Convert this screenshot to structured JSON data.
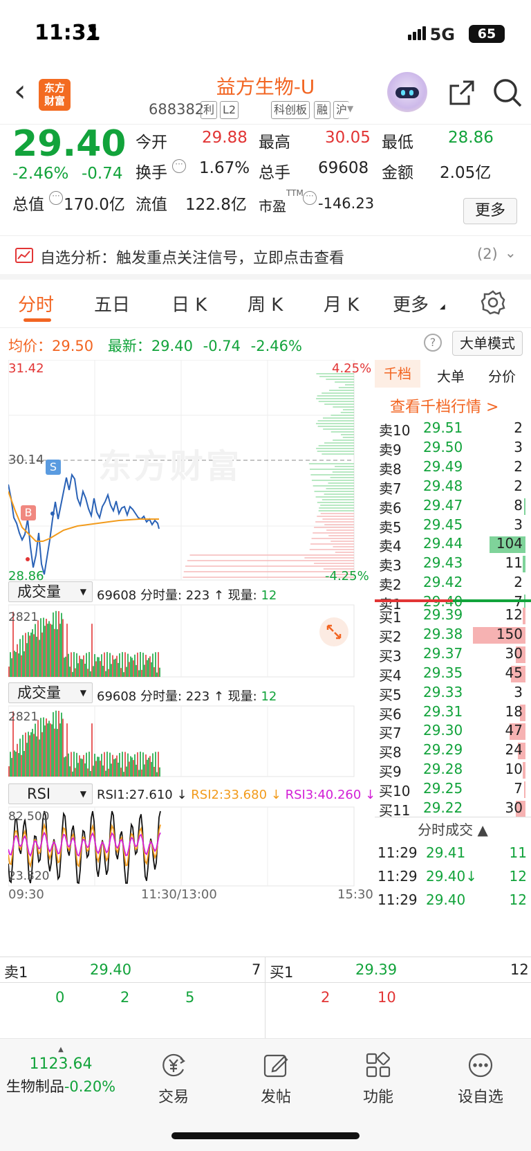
{
  "status_bar": {
    "time": "11:31",
    "network": "5G",
    "battery": "65"
  },
  "header": {
    "logo_line1": "东方",
    "logo_line2": "财富",
    "stock_name": "益方生物-U",
    "stock_code": "688382",
    "tags": [
      "利",
      "L2",
      "科创板",
      "融",
      "沪"
    ]
  },
  "quote": {
    "price": "29.40",
    "change_pct": "-2.46%",
    "change": "-0.74",
    "open_label": "今开",
    "open": "29.88",
    "high_label": "最高",
    "high": "30.05",
    "low_label": "最低",
    "low": "28.86",
    "turnover_label": "换手",
    "turnover": "1.67%",
    "volume_label": "总手",
    "volume": "69608",
    "amount_label": "金额",
    "amount": "2.05亿",
    "mcap_label": "总值",
    "mcap": "170.0亿",
    "float_label": "流值",
    "float": "122.8亿",
    "pe_label": "市盈",
    "pe_sup": "TTM",
    "pe": "-146.23",
    "more_label": "更多"
  },
  "alert": {
    "text": "自选分析：触发重点关注信号，立即点击查看",
    "count": "(2)"
  },
  "tabs": [
    "分时",
    "五日",
    "日 K",
    "周 K",
    "月 K",
    "更多"
  ],
  "chart_info": {
    "avg_label": "均价：",
    "avg": "29.50",
    "latest_label": "最新：",
    "latest": "29.40",
    "chg": "-0.74",
    "chg_pct": "-2.46%",
    "help": "?",
    "bigmode": "大单模式"
  },
  "chart_labels": {
    "ymax": "31.42",
    "ymid": "30.14",
    "ymin": "28.86",
    "pmax": "4.25%",
    "pmin": "-4.25%",
    "watermark": "东方财富",
    "b_marker": "B",
    "s_marker": "S",
    "vol_max": "2821",
    "rsi_max": "82.500",
    "rsi_min": "23.320",
    "time_start": "09:30",
    "time_mid": "11:30/13:00",
    "time_end": "15:30"
  },
  "indicator1": {
    "name": "成交量",
    "total": "69608",
    "label": "分时量: 223 ↑ 现量: ",
    "now": "12"
  },
  "indicator2": {
    "name": "成交量",
    "total": "69608",
    "label": "分时量: 223 ↑ 现量: ",
    "now": "12"
  },
  "indicator3": {
    "name": "RSI",
    "rsi1": "RSI1:27.610 ↓",
    "rsi2": "RSI2:33.680 ↓",
    "rsi3": "RSI3:40.260 ↓"
  },
  "book_tabs": [
    "千档",
    "大单",
    "分价"
  ],
  "book_link": "查看千档行情 >",
  "asks": [
    {
      "label": "卖10",
      "price": "29.51",
      "vol": "2",
      "bar": 0
    },
    {
      "label": "卖9",
      "price": "29.50",
      "vol": "3",
      "bar": 0
    },
    {
      "label": "卖8",
      "price": "29.49",
      "vol": "2",
      "bar": 0
    },
    {
      "label": "卖7",
      "price": "29.48",
      "vol": "2",
      "bar": 0
    },
    {
      "label": "卖6",
      "price": "29.47",
      "vol": "8",
      "bar": 0.03
    },
    {
      "label": "卖5",
      "price": "29.45",
      "vol": "3",
      "bar": 0
    },
    {
      "label": "卖4",
      "price": "29.44",
      "vol": "104",
      "bar": 0.69
    },
    {
      "label": "卖3",
      "price": "29.43",
      "vol": "11",
      "bar": 0.05
    },
    {
      "label": "卖2",
      "price": "29.42",
      "vol": "2",
      "bar": 0
    },
    {
      "label": "卖1",
      "price": "29.40",
      "vol": "7",
      "bar": 0.03
    }
  ],
  "bids": [
    {
      "label": "买1",
      "price": "29.39",
      "vol": "12",
      "bar": 0.05
    },
    {
      "label": "买2",
      "price": "29.38",
      "vol": "150",
      "bar": 1.0
    },
    {
      "label": "买3",
      "price": "29.37",
      "vol": "30",
      "bar": 0.18
    },
    {
      "label": "买4",
      "price": "29.35",
      "vol": "45",
      "bar": 0.28
    },
    {
      "label": "买5",
      "price": "29.33",
      "vol": "3",
      "bar": 0
    },
    {
      "label": "买6",
      "price": "29.31",
      "vol": "18",
      "bar": 0.1
    },
    {
      "label": "买7",
      "price": "29.30",
      "vol": "47",
      "bar": 0.3
    },
    {
      "label": "买8",
      "price": "29.29",
      "vol": "24",
      "bar": 0.14
    },
    {
      "label": "买9",
      "price": "29.28",
      "vol": "10",
      "bar": 0.05
    },
    {
      "label": "买10",
      "price": "29.25",
      "vol": "7",
      "bar": 0.03
    },
    {
      "label": "买11",
      "price": "29.22",
      "vol": "30",
      "bar": 0.18
    }
  ],
  "trades_title": "分时成交 ▲",
  "trades": [
    {
      "time": "11:29",
      "price": "29.41",
      "vol": "11"
    },
    {
      "time": "11:29",
      "price": "29.40↓",
      "vol": "12"
    },
    {
      "time": "11:29",
      "price": "29.40",
      "vol": "12"
    }
  ],
  "bottom_quote": {
    "sell_label": "卖1",
    "sell_price": "29.40",
    "sell_vol": "7",
    "buy_label": "买1",
    "buy_price": "29.39",
    "buy_vol": "12",
    "sell_breakdown": [
      "0",
      "2",
      "5"
    ],
    "buy_breakdown": [
      "2",
      "10"
    ]
  },
  "footer": {
    "index_value": "1123.64",
    "index_name": "生物制品",
    "index_chg": "-0.20%",
    "items": [
      "交易",
      "发帖",
      "功能",
      "设自选"
    ]
  },
  "colors": {
    "up": "#e23535",
    "down": "#12a33b",
    "accent": "#f26522",
    "price_line": "#2a62b6",
    "avg_line": "#f29b1c",
    "rsi2": "#f29b1c",
    "rsi3": "#d21fd6"
  }
}
